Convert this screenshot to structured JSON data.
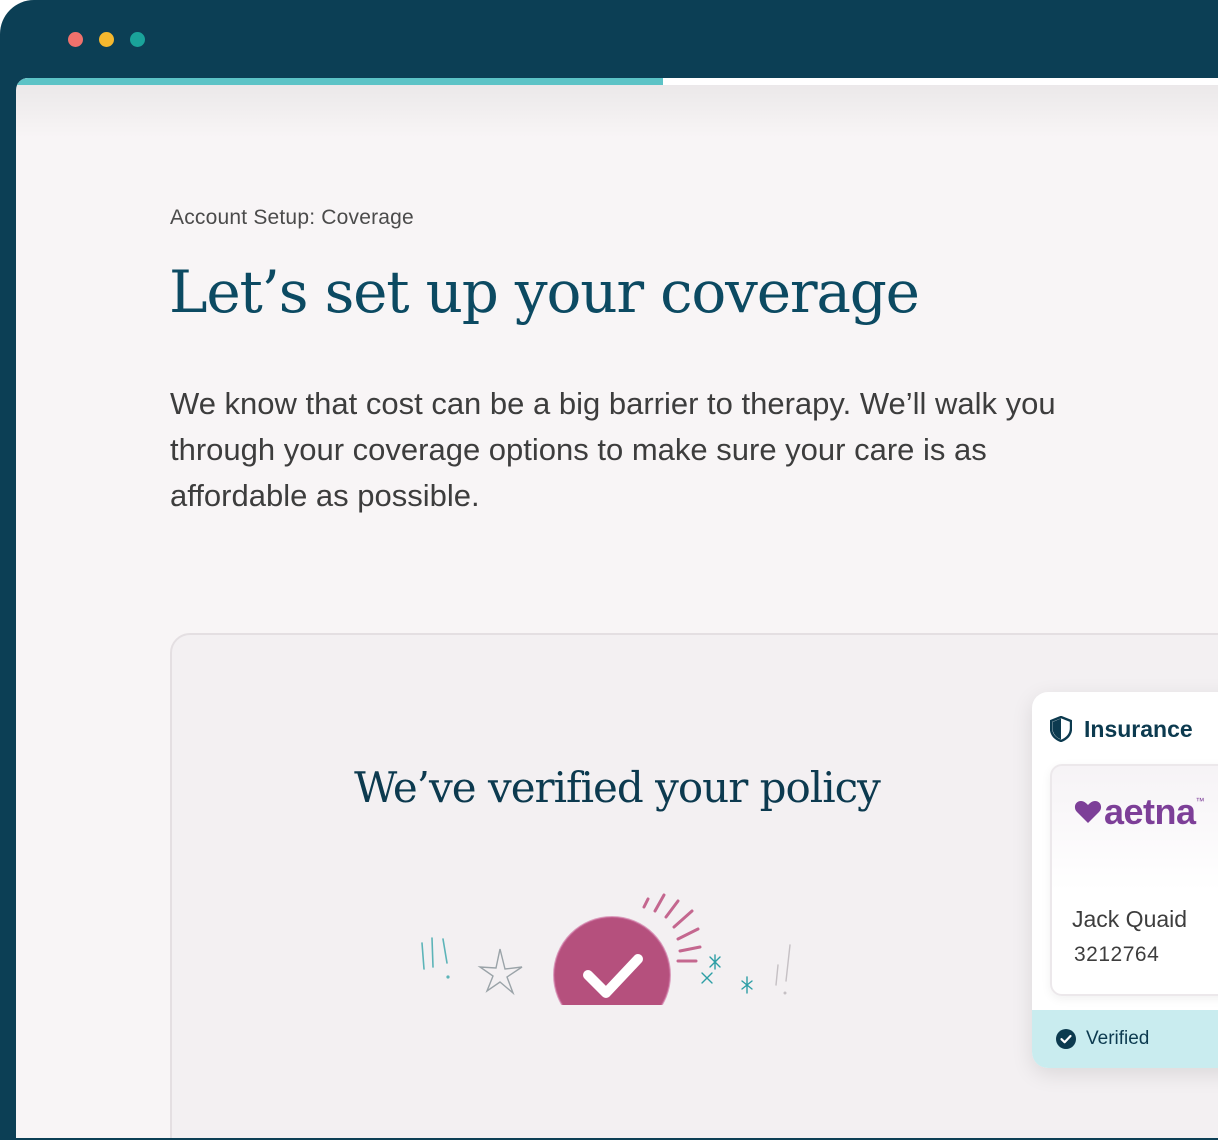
{
  "window": {
    "controls": [
      "close",
      "minimize",
      "maximize"
    ]
  },
  "progress": {
    "fraction": 0.53
  },
  "page": {
    "eyebrow": "Account Setup: Coverage",
    "headline": "Let’s set up your coverage",
    "intro": "We know that cost can be a big barrier to therapy. We’ll walk you through your coverage options to make sure your care is as affordable as possible."
  },
  "status_card": {
    "title": "We’ve verified your policy",
    "icon": "check-circle-icon"
  },
  "insurance": {
    "title": "Insurance",
    "icon": "shield-icon",
    "carrier_logo": {
      "text": "aetna",
      "tm": "™"
    },
    "member_name": "Jack Quaid",
    "member_id": "3212764",
    "status": "Verified"
  },
  "colors": {
    "window_frame": "#0c3f55",
    "progress": "#5cc3c6",
    "headline": "#0c4a62",
    "check_badge": "#b5507d",
    "aetna_purple": "#7d3f98",
    "verified_bg": "#c9ecef"
  }
}
